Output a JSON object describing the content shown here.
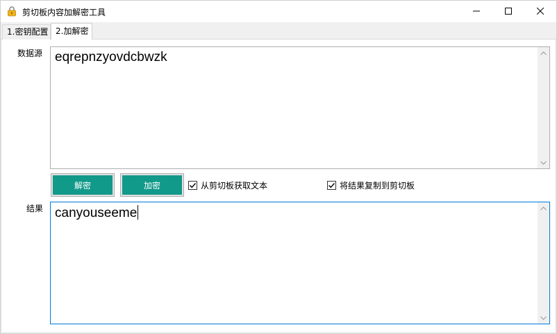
{
  "window": {
    "title": "剪切板内容加解密工具"
  },
  "tabs": [
    {
      "label": "1.密钥配置",
      "active": false
    },
    {
      "label": "2.加解密",
      "active": true
    }
  ],
  "source": {
    "label": "数据源",
    "value": "eqrepnzyovdcbwzk"
  },
  "actions": {
    "decrypt_label": "解密",
    "encrypt_label": "加密",
    "read_clipboard_label": "从剪切板获取文本",
    "read_clipboard_checked": true,
    "copy_result_label": "将结果复制到剪切板",
    "copy_result_checked": true
  },
  "result": {
    "label": "结果",
    "value": "canyouseeme"
  },
  "colors": {
    "button_bg": "#11998a",
    "focus_border": "#0078d7"
  },
  "icons": {
    "app": "lock-icon",
    "minimize": "minimize-icon",
    "maximize": "maximize-icon",
    "close": "close-icon",
    "checkbox": "checkmark-icon"
  }
}
